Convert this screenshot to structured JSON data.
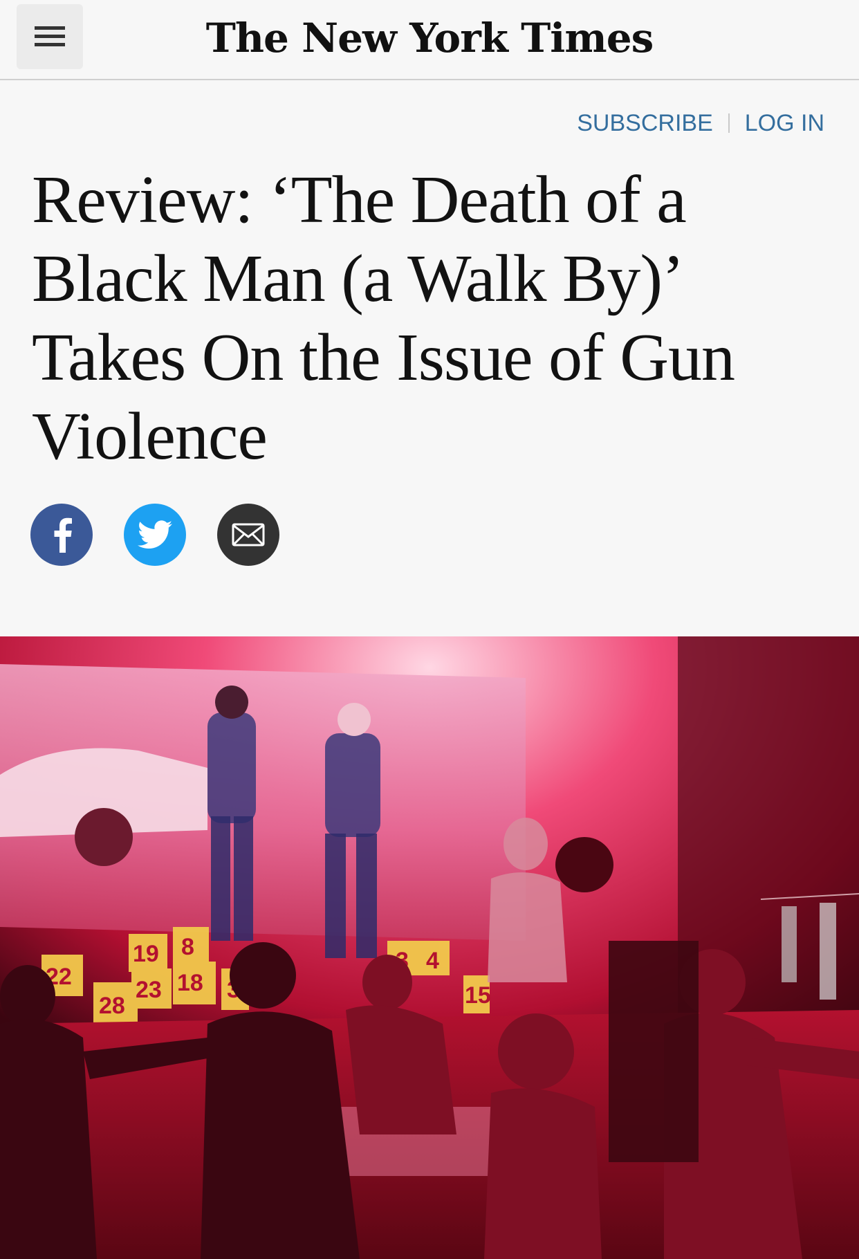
{
  "header": {
    "masthead": "The New York Times",
    "menu_icon": "hamburger-menu-icon"
  },
  "auth": {
    "subscribe_label": "SUBSCRIBE",
    "login_label": "LOG IN"
  },
  "article": {
    "headline": "Review: ‘The Death of a Black Man (a Walk By)’ Takes On the Issue of Gun Violence"
  },
  "share": {
    "facebook_icon": "facebook-icon",
    "twitter_icon": "twitter-icon",
    "email_icon": "email-icon"
  },
  "photo": {
    "markers": [
      "22",
      "28",
      "19",
      "8",
      "23",
      "18",
      "3",
      "3",
      "4",
      "15"
    ]
  },
  "colors": {
    "link": "#346e9e",
    "facebook": "#3b5998",
    "twitter": "#1da1f2",
    "email": "#333333",
    "stage_red": "#c4122f"
  }
}
